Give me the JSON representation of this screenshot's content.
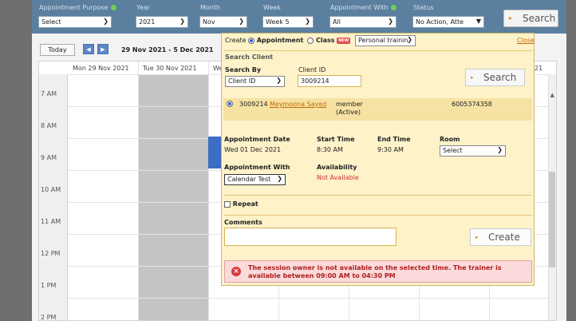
{
  "filters": {
    "purpose": {
      "label": "Appointment Purpose",
      "value": "Select"
    },
    "year": {
      "label": "Year",
      "value": "2021"
    },
    "month": {
      "label": "Month",
      "value": "Nov"
    },
    "week": {
      "label": "Week",
      "value": "Week 5"
    },
    "appointment_with": {
      "label": "Appointment With",
      "value": "All"
    },
    "status": {
      "label": "Status",
      "value": "No Action, Atte"
    },
    "search_label": "Search",
    "accent_color": "#6fcf5a"
  },
  "calendar": {
    "today_label": "Today",
    "date_range": "29 Nov 2021 - 5 Dec 2021",
    "columns": [
      "Mon 29 Nov 2021",
      "Tue 30 Nov 2021",
      "We",
      "21"
    ],
    "times": [
      "7 AM",
      "8 AM",
      "9 AM",
      "10 AM",
      "11 AM",
      "12 PM",
      "1 PM",
      "2 PM"
    ]
  },
  "popup": {
    "create_label": "Create",
    "appointment_option": "Appointment",
    "class_option": "Class",
    "new_badge": "NEW",
    "type_value": "Personal trainin",
    "close_label": "Close",
    "search_client_label": "Search Client",
    "search_by_label": "Search By",
    "search_by_value": "Client ID",
    "client_id_label": "Client ID",
    "client_id_value": "3009214",
    "search_label": "Search",
    "result": {
      "id": "3009214",
      "name": "Meymoona Sayed",
      "type": "member",
      "state": "(Active)",
      "phone": "6005374358"
    },
    "appointment_date_label": "Appointment Date",
    "appointment_date_value": "Wed 01 Dec 2021",
    "start_time_label": "Start Time",
    "start_time_value": "8:30 AM",
    "end_time_label": "End Time",
    "end_time_value": "9:30 AM",
    "room_label": "Room",
    "room_value": "Select",
    "appointment_with_label": "Appointment With",
    "appointment_with_value": "Calendar Test",
    "availability_label": "Availability",
    "availability_value": "Not Available",
    "repeat_label": "Repeat",
    "comments_label": "Comments",
    "create_button_label": "Create",
    "error_message": "The session owner is not available on the selected time. The trainer is available between 09:00 AM to 04:30 PM",
    "error_color": "#d83a3a",
    "link_color": "#c46a00"
  }
}
